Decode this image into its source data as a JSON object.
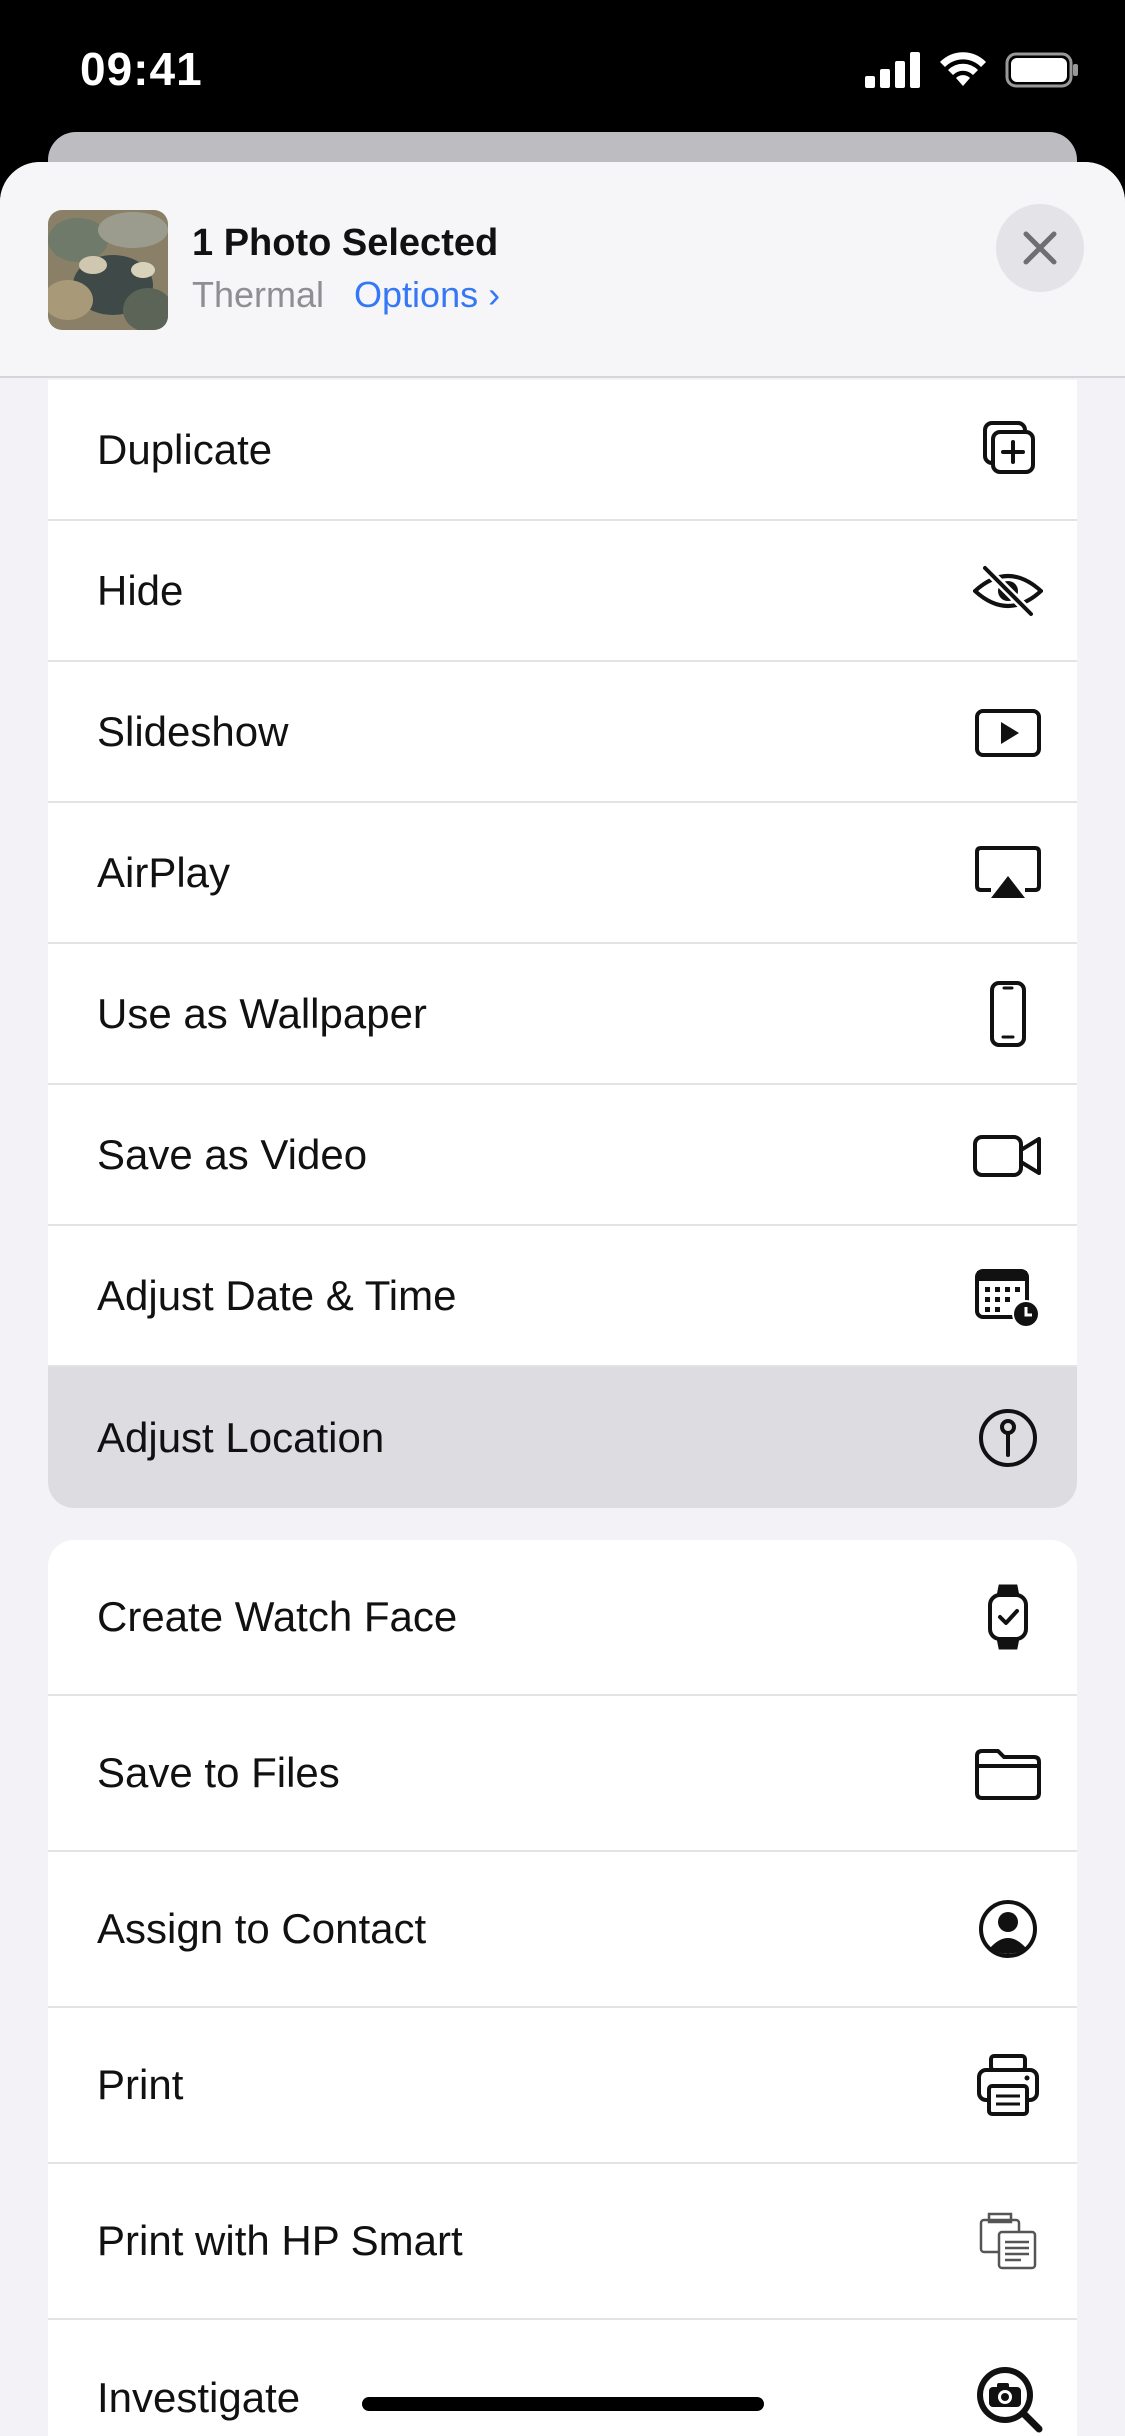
{
  "status_bar": {
    "time": "09:41"
  },
  "header": {
    "title": "1 Photo Selected",
    "album": "Thermal",
    "options_label": "Options",
    "options_chevron": "›"
  },
  "actions_group_1": [
    {
      "label": "Duplicate",
      "icon": "duplicate-icon"
    },
    {
      "label": "Hide",
      "icon": "eye-slash-icon"
    },
    {
      "label": "Slideshow",
      "icon": "play-rectangle-icon"
    },
    {
      "label": "AirPlay",
      "icon": "airplay-icon"
    },
    {
      "label": "Use as Wallpaper",
      "icon": "iphone-icon"
    },
    {
      "label": "Save as Video",
      "icon": "video-camera-icon"
    },
    {
      "label": "Adjust Date & Time",
      "icon": "calendar-clock-icon"
    },
    {
      "label": "Adjust Location",
      "icon": "location-pin-icon",
      "highlighted": true
    }
  ],
  "actions_group_2": [
    {
      "label": "Create Watch Face",
      "icon": "watch-icon"
    },
    {
      "label": "Save to Files",
      "icon": "folder-icon"
    },
    {
      "label": "Assign to Contact",
      "icon": "person-circle-icon"
    },
    {
      "label": "Print",
      "icon": "printer-icon"
    },
    {
      "label": "Print with HP Smart",
      "icon": "hp-smart-icon"
    },
    {
      "label": "Investigate",
      "icon": "camera-magnifier-icon"
    }
  ],
  "colors": {
    "accent": "#3478f6",
    "sheet_background": "#f2f2f7",
    "highlight_row": "#dcdce1"
  }
}
